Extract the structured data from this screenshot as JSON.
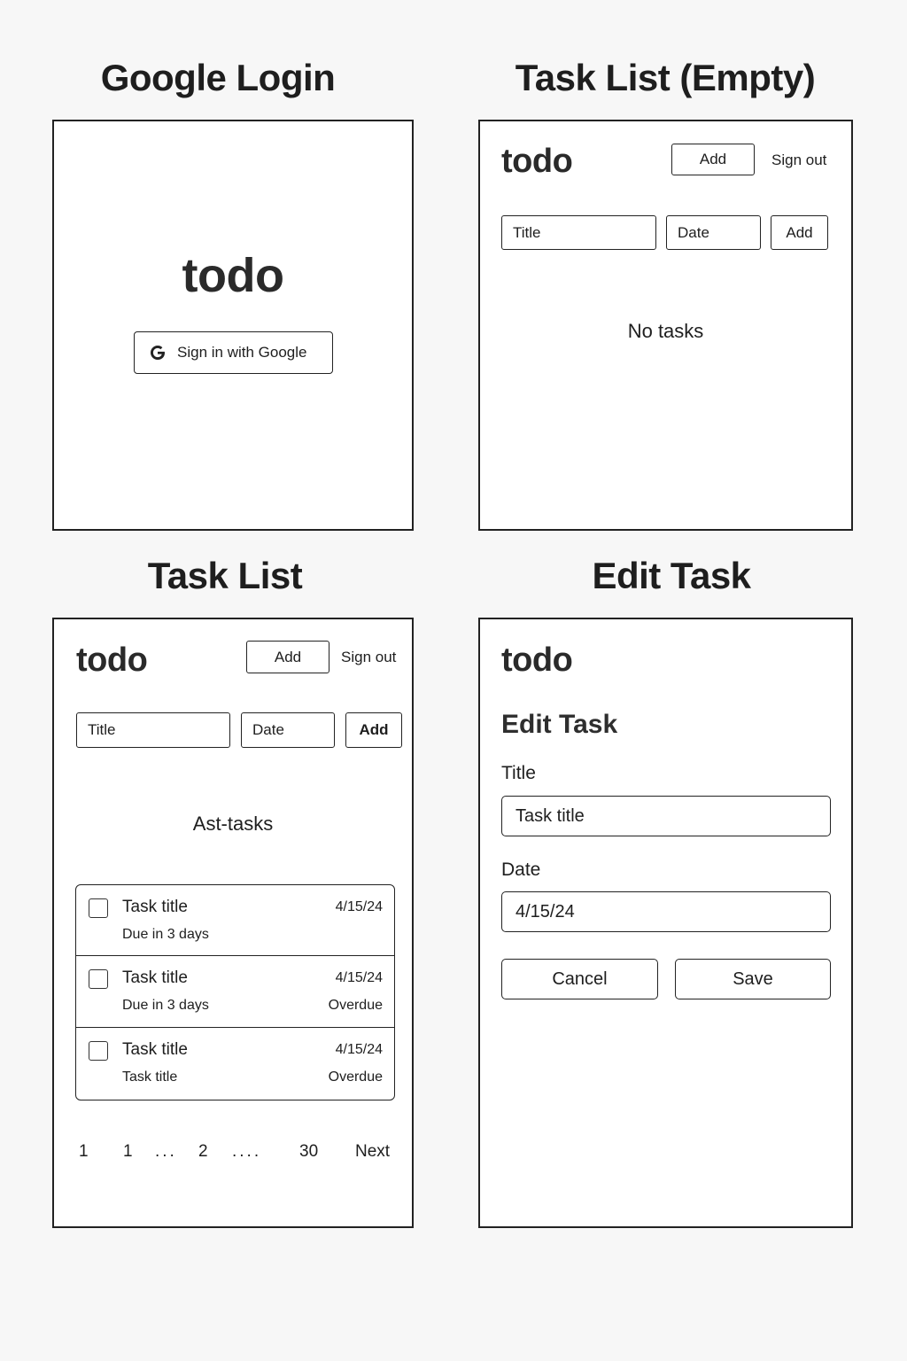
{
  "screens": {
    "login": {
      "heading": "Google Login",
      "logo": "todo",
      "google_button_label": "Sign in with Google",
      "google_icon": "google-g-icon"
    },
    "empty_list": {
      "heading": "Task List (Empty)",
      "logo": "todo",
      "add_button_label": "Add",
      "sign_out_label": "Sign out",
      "title_placeholder": "Title",
      "date_placeholder": "Date",
      "form_add_label": "Add",
      "empty_message": "No tasks"
    },
    "task_list": {
      "heading": "Task List",
      "logo": "todo",
      "add_button_label": "Add",
      "sign_out_label": "Sign out",
      "title_placeholder": "Title",
      "date_placeholder": "Date",
      "form_add_label": "Add",
      "list_heading": "Ast-tasks",
      "tasks": [
        {
          "title": "Task title",
          "subtitle": "Due in 3 days",
          "date": "4/15/24",
          "status": ""
        },
        {
          "title": "Task title",
          "subtitle": "Due in 3 days",
          "date": "4/15/24",
          "status": "Overdue"
        },
        {
          "title": "Task title",
          "subtitle": "Task title",
          "date": "4/15/24",
          "status": "Overdue"
        }
      ],
      "pagination": [
        "1",
        "1",
        "...",
        "2",
        "....",
        "30",
        "Next"
      ]
    },
    "edit_task": {
      "heading": "Edit Task",
      "logo": "todo",
      "form_heading": "Edit Task",
      "title_label": "Title",
      "title_value": "Task title",
      "date_label": "Date",
      "date_value": "4/15/24",
      "cancel_label": "Cancel",
      "save_label": "Save"
    }
  }
}
